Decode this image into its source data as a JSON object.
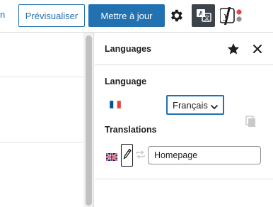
{
  "header": {
    "left_link_fragment": "n",
    "preview_label": "Prévisualiser",
    "update_label": "Mettre à jour"
  },
  "icons": {
    "settings": "gear-icon",
    "languages": "translate-icon",
    "yoast": "yoast-icon",
    "favorite": "star-icon",
    "close": "close-icon",
    "copy": "copy-icon",
    "edit": "pencil-icon",
    "sync": "sync-icon"
  },
  "panel": {
    "title": "Languages",
    "language_label": "Language",
    "language_value": "Français",
    "translations_label": "Translations",
    "translation_title_value": "Homepage"
  },
  "colors": {
    "accent": "#2271b1",
    "dark_icon_bg": "#3c434a",
    "yoast_red": "#e2454e"
  }
}
